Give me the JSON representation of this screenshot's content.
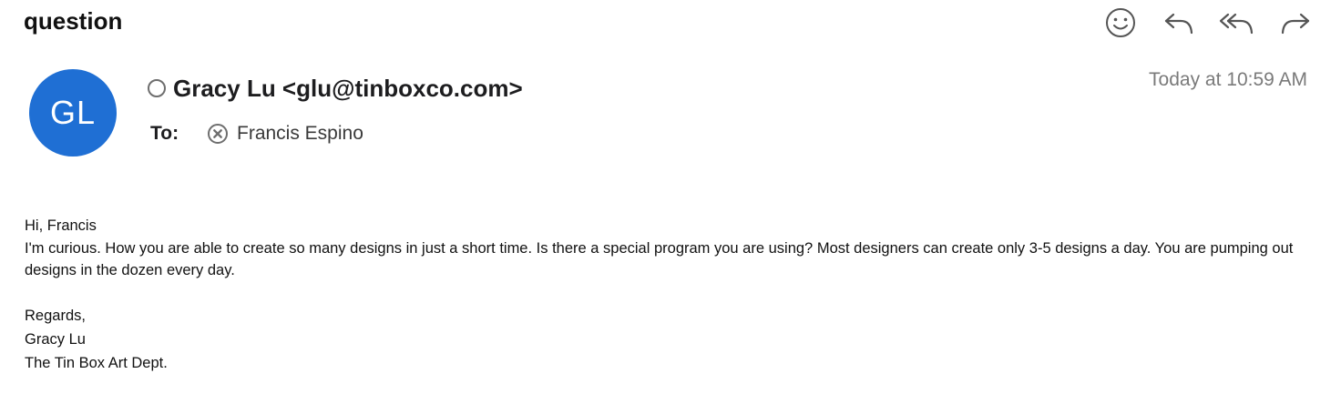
{
  "message": {
    "subject": "question",
    "sender": {
      "initials": "GL",
      "display": "Gracy Lu <glu@tinboxco.com>"
    },
    "to_label": "To:",
    "recipient": "Francis Espino",
    "date": "Today at 10:59 AM",
    "body": {
      "greeting": "Hi, Francis",
      "paragraph": "I'm curious. How you are able to create so many designs in just a short time. Is there a special program you are using? Most designers can create only 3-5 designs a day. You are pumping out designs in the dozen every day.",
      "closing": "Regards,",
      "signature_name": "Gracy Lu",
      "signature_org": "The Tin Box Art Dept."
    }
  },
  "toolbar": {
    "icons": [
      "smiley-icon",
      "reply-icon",
      "reply-all-icon",
      "forward-icon"
    ]
  },
  "colors": {
    "avatar": "#1f6fd4",
    "icon": "#555555",
    "date": "#7a7a7a"
  }
}
